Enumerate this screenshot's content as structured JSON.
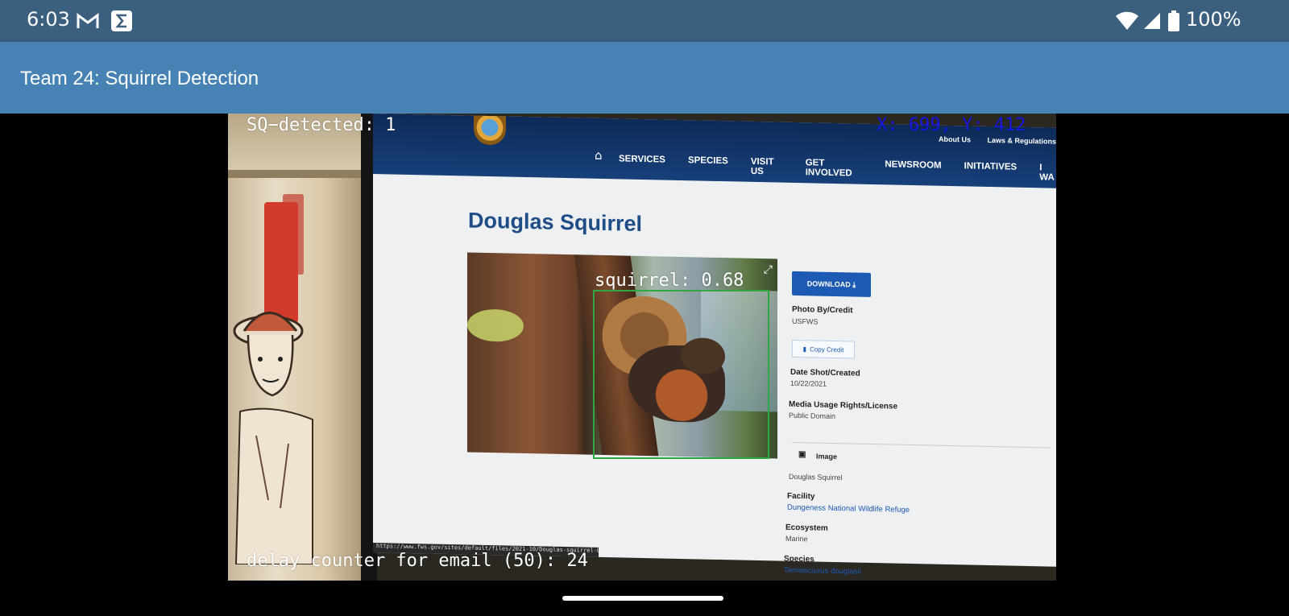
{
  "status_bar": {
    "time": "6:03",
    "battery_percent": "100%",
    "icons": [
      "gmail-icon",
      "sigma-app-icon",
      "wifi-icon",
      "cell-signal-icon",
      "battery-icon"
    ]
  },
  "app_bar": {
    "title": "Team 24: Squirrel Detection"
  },
  "camera_overlay": {
    "detected_label": "SQ−detected: 1",
    "coords_label": "X: 699, Y: 412",
    "detection_label": "squirrel: 0.68",
    "delay_label": "delay counter for email (50): 24",
    "box_color": "#2fa844",
    "coords_color": "#1a1ae6"
  },
  "captured_site": {
    "top_links": [
      "About Us",
      "Laws & Regulations"
    ],
    "menu": [
      "SERVICES",
      "SPECIES",
      "VISIT US",
      "GET INVOLVED",
      "NEWSROOM",
      "INITIATIVES",
      "I WA"
    ],
    "page_title": "Douglas Squirrel",
    "download_label": "DOWNLOAD ⤓",
    "photo_credit_label": "Photo By/Credit",
    "photo_credit_value": "USFWS",
    "copy_credit_label": "Copy Credit",
    "date_label": "Date Shot/Created",
    "date_value": "10/22/2021",
    "rights_label": "Media Usage Rights/License",
    "rights_value": "Public Domain",
    "media_type_label": "Image",
    "caption": "Douglas Squirrel",
    "facility_label": "Facility",
    "facility_value": "Dungeness National Wildlife Refuge",
    "ecosystem_label": "Ecosystem",
    "ecosystem_value": "Marine",
    "species_label": "Species",
    "species_value": "Tamiasciurus douglasii",
    "url_text": "https://www.fws.gov/sites/default/files/2021-10/Douglas-squirrel-USFWS.jpg"
  }
}
